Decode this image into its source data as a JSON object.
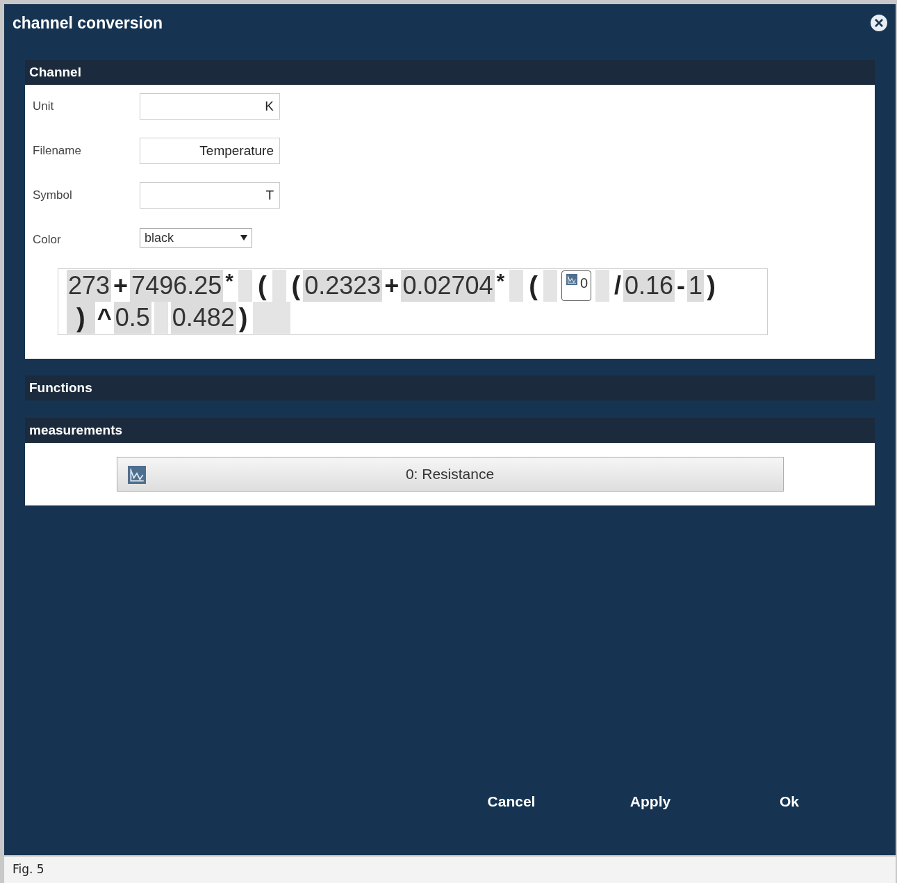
{
  "window": {
    "title": "channel conversion"
  },
  "channel": {
    "title": "Channel",
    "fields": [
      {
        "kind": "text",
        "label": "Unit",
        "value": "K"
      },
      {
        "kind": "text",
        "label": "Filename",
        "value": "Temperature"
      },
      {
        "kind": "text",
        "label": "Symbol",
        "value": "T"
      },
      {
        "kind": "select",
        "label": "Color",
        "value": "black"
      }
    ],
    "formula": [
      {
        "kind": "number",
        "text": "273"
      },
      {
        "kind": "operator",
        "text": "+"
      },
      {
        "kind": "number",
        "text": "7496.25"
      },
      {
        "kind": "raised",
        "text": "*"
      },
      {
        "kind": "slot"
      },
      {
        "kind": "paren",
        "text": "("
      },
      {
        "kind": "slot"
      },
      {
        "kind": "paren",
        "text": "("
      },
      {
        "kind": "number",
        "text": "0.2323"
      },
      {
        "kind": "operator",
        "text": "+"
      },
      {
        "kind": "number",
        "text": "0.02704"
      },
      {
        "kind": "raised",
        "text": "*"
      },
      {
        "kind": "slot"
      },
      {
        "kind": "paren",
        "text": "("
      },
      {
        "kind": "slot"
      },
      {
        "kind": "reference",
        "text": "0"
      },
      {
        "kind": "slot"
      },
      {
        "kind": "operator",
        "text": "/"
      },
      {
        "kind": "number",
        "text": "0.16"
      },
      {
        "kind": "operator",
        "text": "-"
      },
      {
        "kind": "number",
        "text": "1"
      },
      {
        "kind": "paren",
        "text": ")"
      },
      {
        "kind": "break"
      },
      {
        "kind": "slot_paren",
        "text": ")"
      },
      {
        "kind": "operator",
        "text": "^"
      },
      {
        "kind": "number",
        "text": "0.5"
      },
      {
        "kind": "slot"
      },
      {
        "kind": "number",
        "text": "0.482"
      },
      {
        "kind": "paren",
        "text": ")"
      },
      {
        "kind": "wide_slot"
      }
    ]
  },
  "functions": {
    "title": "Functions"
  },
  "measurements": {
    "title": "measurements",
    "items": [
      {
        "label": "0: Resistance"
      }
    ]
  },
  "buttons": [
    "Cancel",
    "Apply",
    "Ok"
  ],
  "caption": "Fig. 5"
}
